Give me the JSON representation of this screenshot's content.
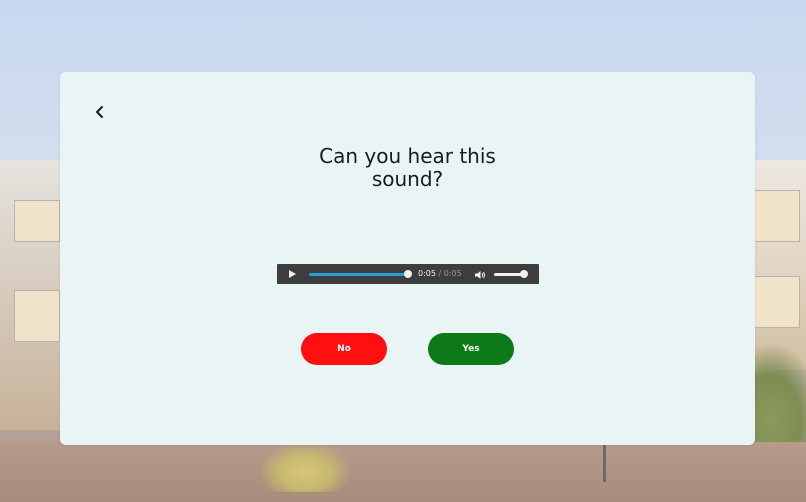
{
  "dialog": {
    "back_icon": "chevron-left-icon",
    "title_line1": "Can you hear this",
    "title_line2": "sound?"
  },
  "audio_player": {
    "play_icon": "play-icon",
    "current_time": "0:05",
    "separator": "/",
    "duration": "0:05",
    "progress_fraction": 1.0,
    "volume_icon": "volume-icon",
    "volume_fraction": 1.0,
    "progress_color": "#2a9fd6"
  },
  "answers": {
    "no_label": "No",
    "no_color": "#ff0f0f",
    "yes_label": "Yes",
    "yes_color": "#0c7a18"
  }
}
